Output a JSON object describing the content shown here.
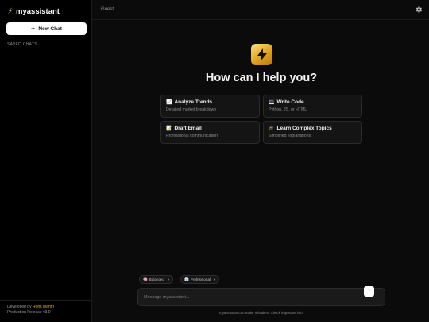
{
  "sidebar": {
    "brand_icon": "lightning-icon",
    "brand_name": "myassistant",
    "new_chat_label": "New Chat",
    "saved_chats_label": "SAVED CHATS",
    "footer": {
      "developed_by_prefix": "Developed by ",
      "author": "Ronit Mantri",
      "release": "Production Release v3.0"
    }
  },
  "header": {
    "user": "Guest",
    "settings_icon": "gear-icon"
  },
  "hero": {
    "icon": "lightning-icon",
    "title": "How can I help you?"
  },
  "suggestions": [
    {
      "emoji": "📈",
      "title": "Analyze Trends",
      "subtitle": "Detailed market breakdown"
    },
    {
      "emoji": "💻",
      "title": "Write Code",
      "subtitle": "Python, JS, or HTML"
    },
    {
      "emoji": "📝",
      "title": "Draft Email",
      "subtitle": "Professional communication"
    },
    {
      "emoji": "🎓",
      "title": "Learn Complex Topics",
      "subtitle": "Simplified explanations"
    }
  ],
  "composer": {
    "mode_select": {
      "emoji": "🧠",
      "value": "Balanced"
    },
    "tone_select": {
      "emoji": "👔",
      "value": "Professional"
    },
    "placeholder": "Message myassistant...",
    "send_icon": "arrow-up-icon",
    "disclaimer": "myassistant can make mistakes. Check important info."
  },
  "colors": {
    "accent": "#e9b23c",
    "background": "#0b0b0b",
    "sidebar": "#000000"
  }
}
